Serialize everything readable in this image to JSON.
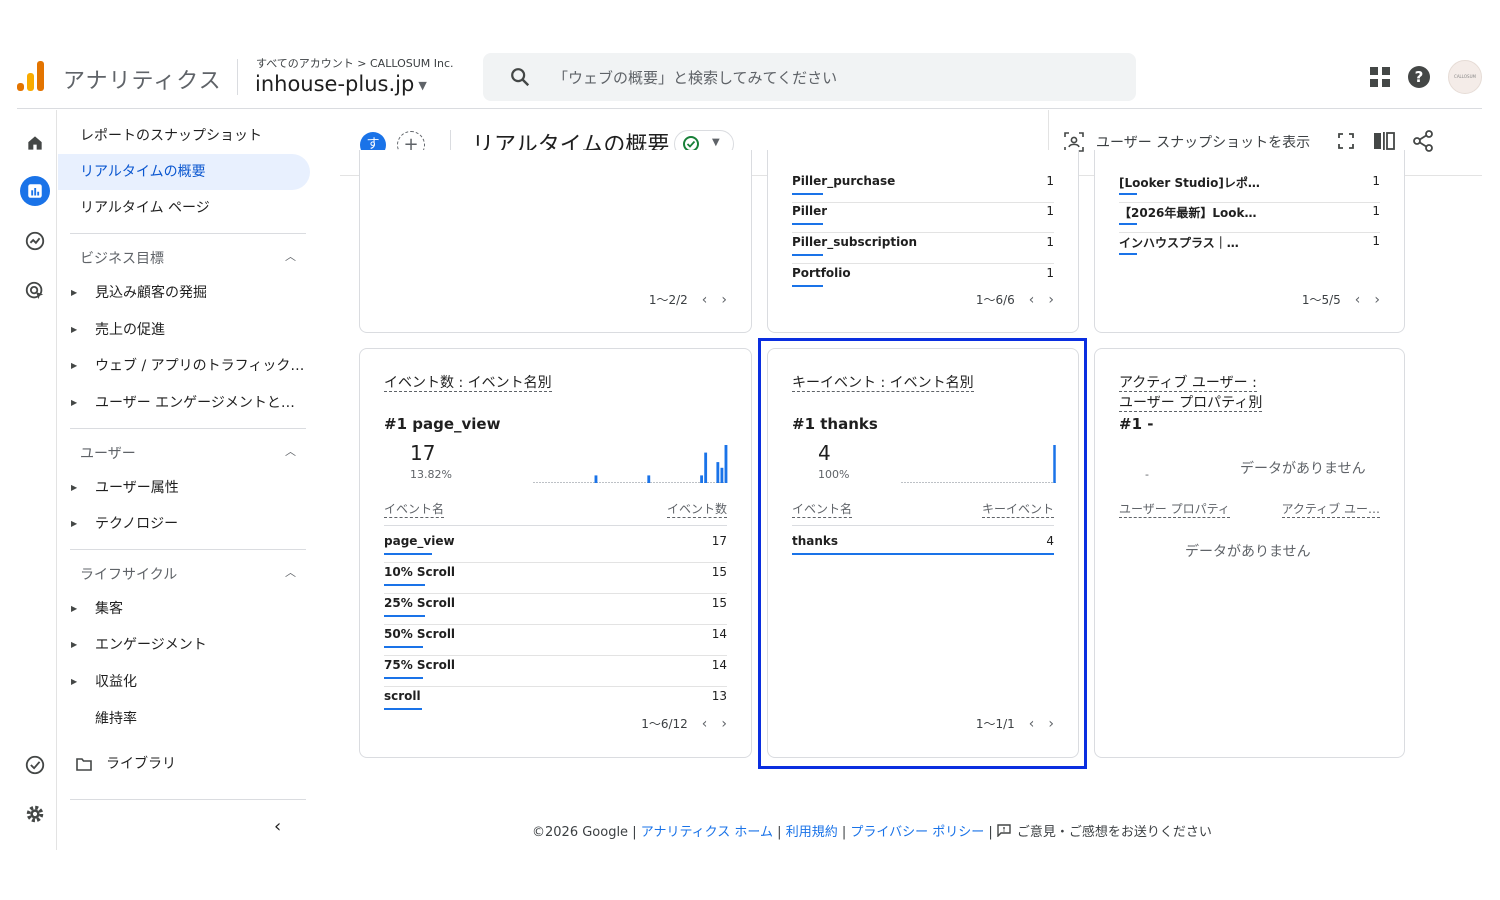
{
  "app": {
    "title": "アナリティクス",
    "breadcrumb": "すべてのアカウント > CALLOSUM Inc.",
    "property": "inhouse-plus.jp",
    "search_placeholder": "「ウェブの概要」と検索してみてください",
    "avatar_text": "CALLOSUM"
  },
  "colors": {
    "accent": "#1a73e8",
    "highlight": "#0a2ee0",
    "logo_orange": "#f9ab00",
    "logo_dark": "#e37400"
  },
  "sidenav": {
    "snapshot": "レポートのスナップショット",
    "realtime_overview": "リアルタイムの概要",
    "realtime_pages": "リアルタイム ページ",
    "section_business": "ビジネス目標",
    "business_items": [
      "見込み顧客の発掘",
      "売上の促進",
      "ウェブ / アプリのトラフィック…",
      "ユーザー エンゲージメントと…"
    ],
    "section_user": "ユーザー",
    "user_items": [
      "ユーザー属性",
      "テクノロジー"
    ],
    "section_lifecycle": "ライフサイクル",
    "lifecycle_items": [
      "集客",
      "エンゲージメント",
      "収益化"
    ],
    "retention": "維持率",
    "library": "ライブラリ"
  },
  "header": {
    "segment_avatar": "す",
    "title": "リアルタイムの概要",
    "snapshot_button": "ユーザー スナップショットを表示"
  },
  "top_cards": {
    "left_pager": "1〜2/2",
    "mid_rows": [
      {
        "label": "Piller_purchase",
        "value": "1",
        "bar": 0.12
      },
      {
        "label": "Piller",
        "value": "1",
        "bar": 0.12
      },
      {
        "label": "Piller_subscription",
        "value": "1",
        "bar": 0.12
      },
      {
        "label": "Portfolio",
        "value": "1",
        "bar": 0.12
      }
    ],
    "mid_pager": "1〜6/6",
    "right_rows": [
      {
        "label": "[Looker Studio]レポ…",
        "value": "1",
        "bar": 0.07
      },
      {
        "label": "【2026年最新】Look…",
        "value": "1",
        "bar": 0.07
      },
      {
        "label": "インハウスプラス｜…",
        "value": "1",
        "bar": 0.07
      }
    ],
    "right_pager": "1〜5/5"
  },
  "events_card": {
    "title": "イベント数 : イベント名別",
    "top_label": "#1  page_view",
    "top_value": "17",
    "top_pct": "13.82%",
    "col_name": "イベント名",
    "col_value": "イベント数",
    "rows": [
      {
        "label": "page_view",
        "value": "17",
        "bar": 0.14
      },
      {
        "label": "10% Scroll",
        "value": "15",
        "bar": 0.12
      },
      {
        "label": "25% Scroll",
        "value": "15",
        "bar": 0.12
      },
      {
        "label": "50% Scroll",
        "value": "14",
        "bar": 0.115
      },
      {
        "label": "75% Scroll",
        "value": "14",
        "bar": 0.115
      },
      {
        "label": "scroll",
        "value": "13",
        "bar": 0.11
      }
    ],
    "pager": "1〜6/12",
    "spark": [
      0,
      0,
      0,
      0,
      0,
      0,
      0,
      0,
      0,
      0,
      0,
      0,
      0,
      0,
      0,
      0.2,
      0,
      0,
      0,
      0,
      0,
      0,
      0,
      0,
      0,
      0,
      0,
      0,
      0.2,
      0,
      0,
      0,
      0,
      0,
      0,
      0,
      0,
      0,
      0,
      0,
      0,
      0.2,
      0.8,
      0,
      0,
      0.55,
      0.4,
      1.0
    ]
  },
  "key_events_card": {
    "title": "キーイベント : イベント名別",
    "top_label": "#1  thanks",
    "top_value": "4",
    "top_pct": "100%",
    "col_name": "イベント名",
    "col_value": "キーイベント",
    "rows": [
      {
        "label": "thanks",
        "value": "4",
        "bar": 1.0
      }
    ],
    "pager": "1〜1/1",
    "spark": [
      0,
      0,
      0,
      0,
      0,
      0,
      0,
      0,
      0,
      0,
      0,
      0,
      0,
      0,
      0,
      0,
      0,
      0,
      0,
      0,
      0,
      0,
      0,
      0,
      0,
      0,
      0,
      0,
      0,
      0,
      0,
      0,
      0,
      0,
      0,
      0,
      0,
      0,
      0,
      0,
      0,
      0,
      0,
      0,
      0,
      0,
      0,
      1.0
    ]
  },
  "active_users_card": {
    "title_line1": "アクティブ ユーザー :",
    "title_line2": "ユーザー プロパティ別",
    "top_label": "#1  -",
    "dash": "-",
    "no_data_top": "データがありません",
    "col_name": "ユーザー プロパティ",
    "col_value": "アクティブ ユー…",
    "no_data_table": "データがありません"
  },
  "footer": {
    "copyright": "©2026 Google | ",
    "home": "アナリティクス ホーム",
    "terms": "利用規約",
    "privacy": "プライバシー ポリシー",
    "sep": " | ",
    "feedback": "ご意見・ご感想をお送りください"
  }
}
